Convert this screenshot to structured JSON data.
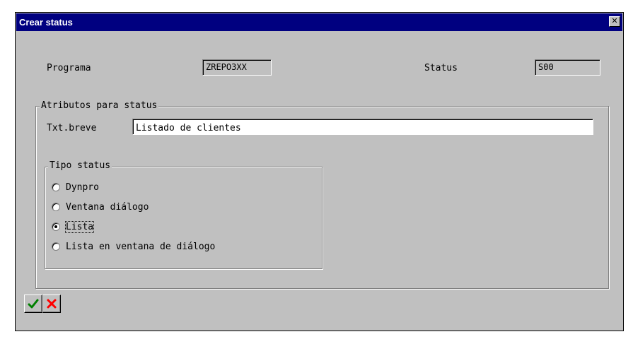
{
  "dialog": {
    "title": "Crear status",
    "close_icon_glyph": "✕"
  },
  "header_fields": {
    "program_label": "Programa",
    "program_value": "ZREPO3XX",
    "status_label": "Status",
    "status_value": "S00"
  },
  "attributes_group": {
    "legend": "Atributos para status",
    "short_text_label": "Txt.breve",
    "short_text_value": "Listado de clientes"
  },
  "status_type_group": {
    "legend": "Tipo status",
    "options": [
      {
        "label": "Dynpro",
        "selected": false
      },
      {
        "label": "Ventana diálogo",
        "selected": false
      },
      {
        "label": "Lista",
        "selected": true
      },
      {
        "label": "Lista en ventana de diálogo",
        "selected": false
      }
    ]
  },
  "toolbar": {
    "confirm_icon": "check-icon",
    "cancel_icon": "cancel-x-icon",
    "confirm_color": "#008000",
    "cancel_color": "#ff0000"
  }
}
